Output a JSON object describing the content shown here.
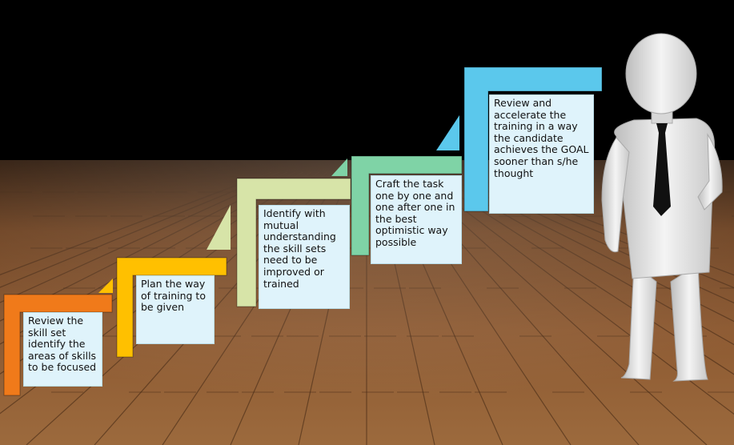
{
  "steps": [
    {
      "text": "Review the skill set identify the areas of skills to be focused",
      "color": "#f07a1a"
    },
    {
      "text": "Plan the way of training to be given",
      "color": "#ffc000"
    },
    {
      "text": "Identify with mutual understanding the skill sets need to be improved or trained",
      "color": "#d7e4a8"
    },
    {
      "text": "Craft the task one by one and one after one in the best optimistic way possible",
      "color": "#7fd3a6"
    },
    {
      "text": "Review and accelerate the training in a way the candidate achieves the GOAL sooner than s/he thought",
      "color": "#5bc8ec"
    }
  ],
  "colors": {
    "floor_wood": "#8a5a33",
    "background": "#000000",
    "figure": "#e9e9e9",
    "tie": "#111111"
  }
}
